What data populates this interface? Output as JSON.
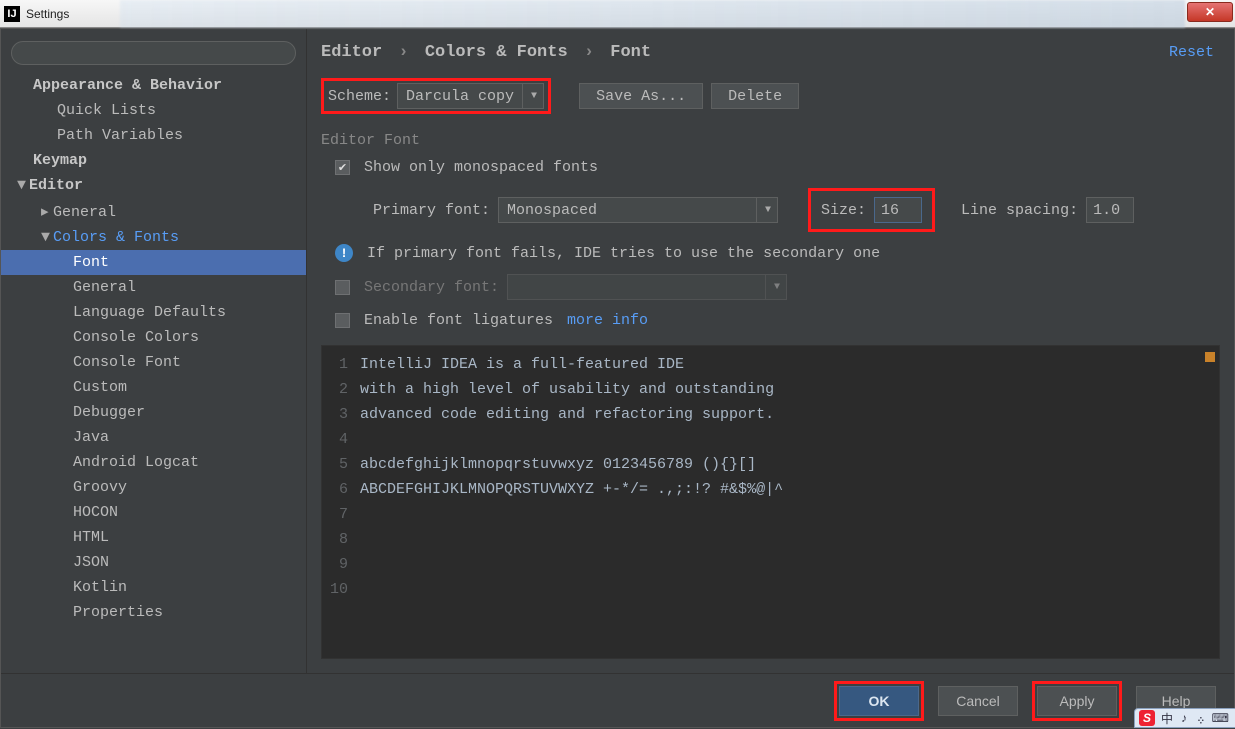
{
  "window": {
    "title": "Settings"
  },
  "sidebar": {
    "search_placeholder": "",
    "items": [
      {
        "label": "Appearance & Behavior",
        "cls": "top",
        "arrow": ""
      },
      {
        "label": "Quick Lists",
        "cls": "lvl1"
      },
      {
        "label": "Path Variables",
        "cls": "lvl1"
      },
      {
        "label": "Keymap",
        "cls": "top"
      },
      {
        "label": "Editor",
        "cls": "top",
        "arrow": "▼"
      },
      {
        "label": "General",
        "cls": "lvl1",
        "arrow": "▸"
      },
      {
        "label": "Colors & Fonts",
        "cls": "lvl1 link",
        "arrow": "▼"
      },
      {
        "label": "Font",
        "cls": "lvl2 selected"
      },
      {
        "label": "General",
        "cls": "lvl2"
      },
      {
        "label": "Language Defaults",
        "cls": "lvl2"
      },
      {
        "label": "Console Colors",
        "cls": "lvl2"
      },
      {
        "label": "Console Font",
        "cls": "lvl2"
      },
      {
        "label": "Custom",
        "cls": "lvl2"
      },
      {
        "label": "Debugger",
        "cls": "lvl2"
      },
      {
        "label": "Java",
        "cls": "lvl2"
      },
      {
        "label": "Android Logcat",
        "cls": "lvl2"
      },
      {
        "label": "Groovy",
        "cls": "lvl2"
      },
      {
        "label": "HOCON",
        "cls": "lvl2"
      },
      {
        "label": "HTML",
        "cls": "lvl2"
      },
      {
        "label": "JSON",
        "cls": "lvl2"
      },
      {
        "label": "Kotlin",
        "cls": "lvl2"
      },
      {
        "label": "Properties",
        "cls": "lvl2"
      }
    ]
  },
  "breadcrumb": {
    "a": "Editor",
    "b": "Colors & Fonts",
    "c": "Font",
    "reset": "Reset"
  },
  "scheme": {
    "label": "Scheme:",
    "value": "Darcula copy",
    "saveas": "Save As...",
    "delete": "Delete"
  },
  "editorFont": {
    "section": "Editor Font",
    "monospaced_label": "Show only monospaced fonts",
    "monospaced_checked": true,
    "primary_label": "Primary font:",
    "primary_value": "Monospaced",
    "size_label": "Size:",
    "size_value": "16",
    "linespacing_label": "Line spacing:",
    "linespacing_value": "1.0",
    "fallback_info": "If primary font fails, IDE tries to use the secondary one",
    "secondary_label": "Secondary font:",
    "secondary_value": "",
    "secondary_checked": false,
    "ligatures_label": "Enable font ligatures",
    "ligatures_checked": false,
    "more_info": "more info"
  },
  "preview": {
    "lines": [
      "IntelliJ IDEA is a full-featured IDE",
      "with a high level of usability and outstanding",
      "advanced code editing and refactoring support.",
      "",
      "abcdefghijklmnopqrstuvwxyz 0123456789 (){}[]",
      "ABCDEFGHIJKLMNOPQRSTUVWXYZ +-*/= .,;:!? #&$%@|^",
      "",
      "",
      "",
      ""
    ]
  },
  "footer": {
    "ok": "OK",
    "cancel": "Cancel",
    "apply": "Apply",
    "help": "Help"
  },
  "tray": {
    "items": [
      "中",
      "♪",
      "᠅",
      "⌨"
    ]
  }
}
